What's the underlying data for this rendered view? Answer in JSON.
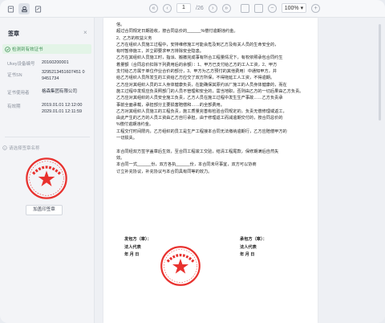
{
  "toolbar": {
    "page_current": "1",
    "page_total": "/26",
    "zoom": "100%"
  },
  "sidebar": {
    "title": "签章",
    "valid_text": "检测到有效证书",
    "fields": [
      {
        "label": "Ukey设备编号",
        "value": "20160200001"
      },
      {
        "label": "证书SN",
        "value": "3295213451607451 0\n9451734"
      },
      {
        "label": "证书使用者",
        "value": "格森集团有限公司"
      },
      {
        "label": "有效期",
        "value": "2019.01.01 12:12:00\n2029.01.01 12:11:59"
      }
    ],
    "signatures_title": "请选择签章名称",
    "add_sign_label": "加盖印签章"
  },
  "document": {
    "lines": [
      "信。",
      "超过合同规定日期验收，按合同总价的______%偿付逾期违约金。",
      "2、乙方的权益义务",
      "乙方在组织人员施工过程中，安排维修施工可能会危及到乙方及有关人员的生命安全的，",
      "有时暂停施工，并立即要求甲方排除安全隐患。",
      "乙方在其组织人员施工时，指派、搬撤完成事有所合工程量情况下，有权依照承包合同约生",
      "着量额（合同总价扣除下列费用后的余额）：1、甲方已支付给乙方的工人工资，2、甲方",
      "支付给乙方属于单位作业合价的部分，3、甲方为乙方预付的其他费用）中通知甲方，并",
      "给乙方组织人员所发生的工资给乙方应交了双方所保，不得拖延工人工资，不得逾期。",
      "乙方应对其组织人员的工人身体健康负责，在能确保其原约派厂施工的人员身体健康的，而在",
      "施工过程中发现应负责照部门的人员不管理和安全的，需当地职，否则由乙方的一切后果由乙方负责。",
      "乙方应对其组织的人员安全施工负责，乙方人员在施工过程中发生生产事故……乙方负责承",
      "事前全面承载，承担部分主要损害赔偿和……的全部费用。",
      "乙方对其组织人员施工的工程负责，施工质量完善有检验合同规定的，负责无偿修理或返工，",
      "由此产生的乙方的人员工资由乙方自行承担，由于修理返工而减逾期交付的，按合同总价的",
      "%偿付逾期违约金。",
      "工程交付时间限内，乙方组织的员工是生产工程接本合同无法缴纳逾期行，乙方应赔偿甲方的",
      "一切损失。",
      "",
      "本合同经双方签字盖章后生效，至合同工程竣工交验，结清工程尾款，保修期满后自然失",
      "效。",
      "本合同一式______份，双方各执______份，本合同未尽事宜，双方可以协商",
      "订立补充协议，补充协议与本合同具有同等的效力。"
    ],
    "sign_left": [
      "发包方（章）：",
      "法人代表",
      "年    月    日"
    ],
    "sign_right": [
      "承包方（章）：",
      "法人代表",
      "年    月    日"
    ]
  },
  "colors": {
    "seal_red": "#e8312e",
    "valid_green": "#3d8f54"
  }
}
